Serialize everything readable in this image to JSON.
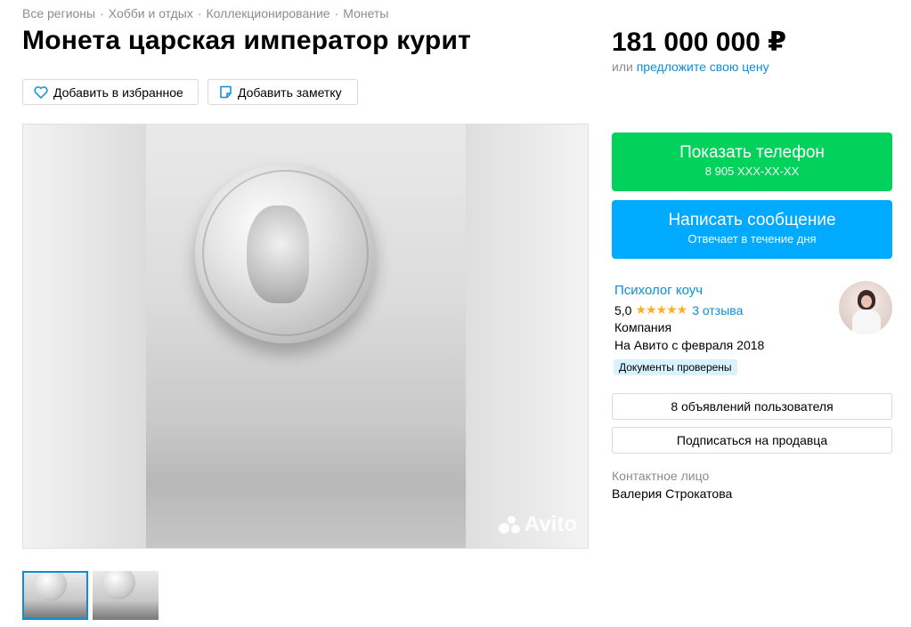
{
  "breadcrumb": [
    "Все регионы",
    "Хобби и отдых",
    "Коллекционирование",
    "Монеты"
  ],
  "listing": {
    "title": "Монета царская император курит",
    "price": "181 000 000 ₽",
    "price_or": "или",
    "offer_price_link": "предложите свою цену"
  },
  "actions": {
    "favorite": "Добавить в избранное",
    "note": "Добавить заметку"
  },
  "gallery": {
    "watermark": "Avito",
    "thumbnail_count": 2,
    "active_thumbnail": 1
  },
  "contact_buttons": {
    "phone_label": "Показать телефон",
    "phone_masked": "8 905 XXX-XX-XX",
    "message_label": "Написать сообщение",
    "message_sub": "Отвечает в течение дня"
  },
  "seller": {
    "name": "Психолог коуч",
    "rating": "5,0",
    "stars": 5,
    "reviews": "3 отзыва",
    "type": "Компания",
    "since": "На Авито с февраля 2018",
    "badge": "Документы проверены",
    "listings_button": "8 объявлений пользователя",
    "subscribe_button": "Подписаться на продавца"
  },
  "contact": {
    "label": "Контактное лицо",
    "name": "Валерия Строкатова"
  },
  "colors": {
    "link": "#0a8fd4",
    "green_button": "#02d15c",
    "blue_button": "#00aaff",
    "star": "#ffb021",
    "badge_bg": "#d9f2ff"
  }
}
